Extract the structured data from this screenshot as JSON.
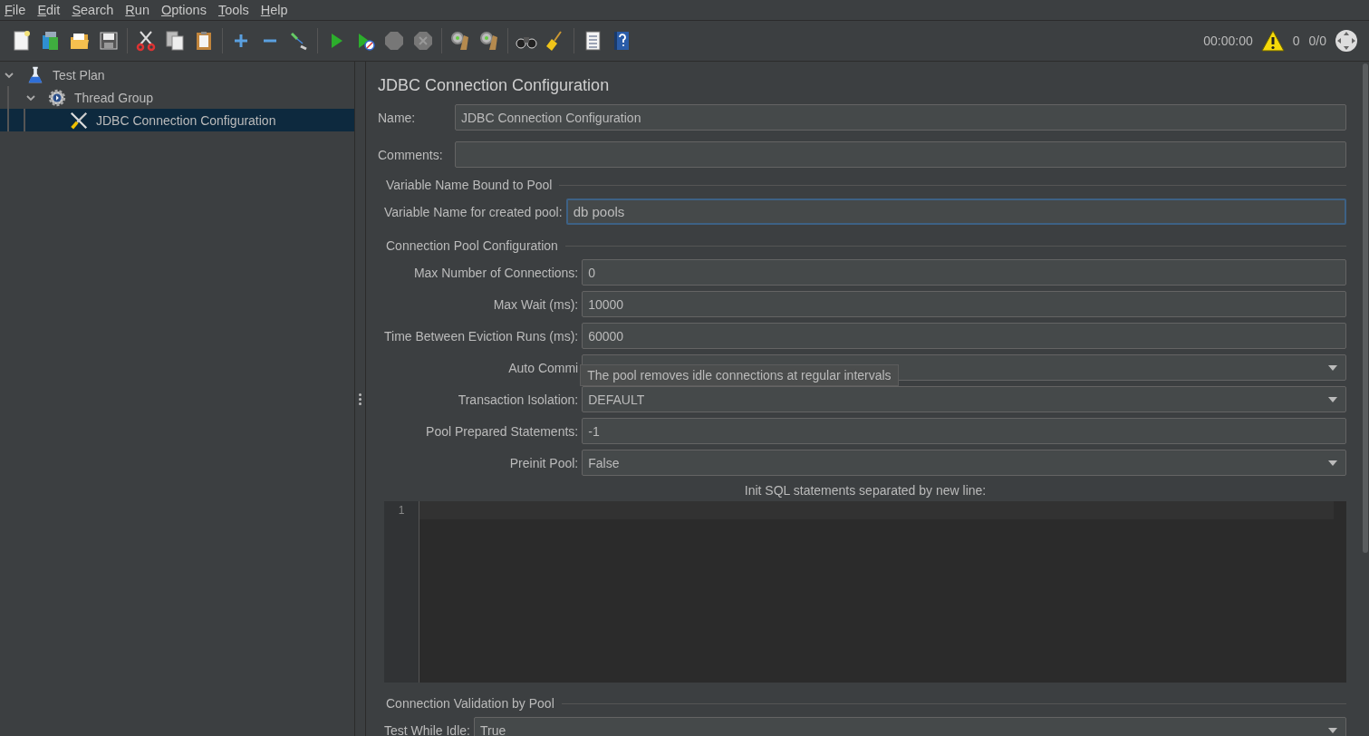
{
  "menu": [
    "File",
    "Edit",
    "Search",
    "Run",
    "Options",
    "Tools",
    "Help"
  ],
  "toolbar": {
    "timer": "00:00:00",
    "warnings": "0",
    "threads": "0/0"
  },
  "tree": [
    {
      "label": "Test Plan",
      "kind": "plan",
      "expanded": true,
      "selected": false,
      "children": [
        {
          "label": "Thread Group",
          "kind": "group",
          "expanded": true,
          "selected": false,
          "children": [
            {
              "label": "JDBC Connection Configuration",
              "kind": "config",
              "selected": true
            }
          ]
        }
      ]
    }
  ],
  "panel": {
    "title": "JDBC Connection Configuration",
    "name": {
      "label": "Name:",
      "value": "JDBC Connection Configuration"
    },
    "comments": {
      "label": "Comments:"
    },
    "sections": [
      {
        "heading": "Variable Name Bound to Pool",
        "items": [
          {
            "kind": "text",
            "label": "Variable Name for created pool:",
            "value": "db pools",
            "focused": true
          }
        ]
      },
      {
        "heading": "Connection Pool Configuration",
        "items": [
          {
            "kind": "text",
            "label": "Max Number of Connections:",
            "value": "0",
            "focused": false
          },
          {
            "kind": "text",
            "label": "Max Wait (ms):",
            "value": "10000",
            "focused": false
          },
          {
            "kind": "text",
            "label": "Time Between Eviction Runs (ms):",
            "value": "60000",
            "focused": false
          },
          {
            "kind": "select",
            "label": "Auto Commi",
            "tooltip": "The pool removes idle connections at regular intervals"
          },
          {
            "kind": "select",
            "label": "Transaction Isolation:",
            "value": "DEFAULT"
          },
          {
            "kind": "text",
            "label": "Pool Prepared Statements:",
            "value": "-1",
            "focused": false
          },
          {
            "kind": "select",
            "label": "Preinit Pool:",
            "value": "False"
          },
          {
            "kind": "editor",
            "label": "Init SQL statements separated by new line:",
            "line_numbers": [
              "1"
            ]
          }
        ]
      },
      {
        "heading": "Connection Validation by Pool",
        "items": [
          {
            "kind": "select",
            "label": "Test While Idle:",
            "value": "True"
          }
        ]
      }
    ]
  }
}
